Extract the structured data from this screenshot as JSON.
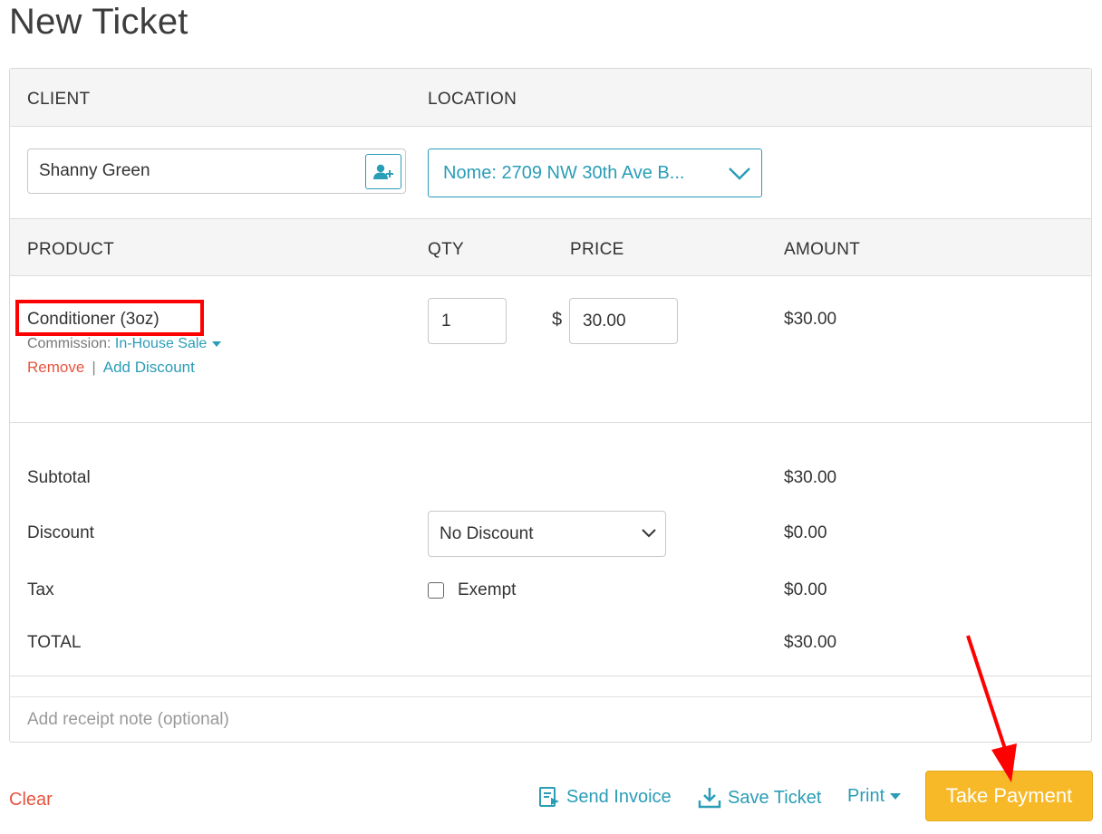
{
  "page": {
    "title": "New Ticket"
  },
  "client_section": {
    "client_header": "CLIENT",
    "location_header": "LOCATION",
    "client_name": "Shanny Green",
    "location_value": "Nome: 2709 NW 30th Ave B..."
  },
  "product_section": {
    "headers": {
      "product": "PRODUCT",
      "qty": "QTY",
      "price": "PRICE",
      "amount": "AMOUNT"
    },
    "line_item": {
      "name": "Conditioner (3oz)",
      "commission_label": "Commission:",
      "commission_value": "In-House Sale",
      "remove_label": "Remove",
      "separator": "|",
      "add_discount_label": "Add Discount",
      "qty": "1",
      "currency": "$",
      "price": "30.00",
      "amount": "$30.00"
    }
  },
  "summary": {
    "subtotal_label": "Subtotal",
    "subtotal_value": "$30.00",
    "discount_label": "Discount",
    "discount_selected": "No Discount",
    "discount_value": "$0.00",
    "tax_label": "Tax",
    "exempt_label": "Exempt",
    "exempt_checked": false,
    "tax_value": "$0.00",
    "total_label": "TOTAL",
    "total_value": "$30.00"
  },
  "receipt_note": {
    "placeholder": "Add receipt note (optional)"
  },
  "footer": {
    "clear_label": "Clear",
    "send_invoice_label": "Send Invoice",
    "save_ticket_label": "Save Ticket",
    "print_label": "Print",
    "take_payment_label": "Take Payment"
  },
  "colors": {
    "accent": "#2a9db7",
    "danger": "#e8543f",
    "primary_button": "#f7b928",
    "highlight": "#ff0000"
  },
  "icons": {
    "client_add": "add-user-icon",
    "location_dropdown": "chevron-down-icon",
    "send_invoice": "invoice-icon",
    "save_ticket": "download-icon"
  }
}
